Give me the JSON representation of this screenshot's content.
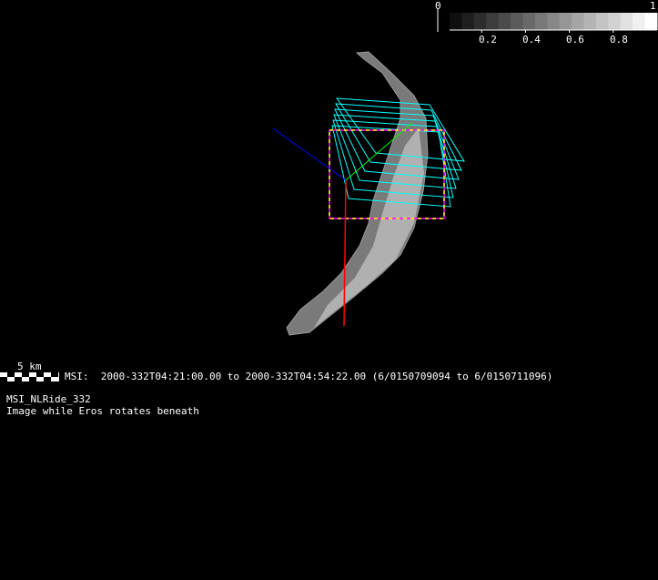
{
  "colorbar": {
    "min_label": "0",
    "max_label": "1",
    "tick_labels": [
      "0.2",
      "0.4",
      "0.6",
      "0.8"
    ],
    "segments": 17
  },
  "scale_bar": {
    "label": "5 km"
  },
  "info": {
    "time_range": "MSI:  2000-332T04:21:00.00 to 2000-332T04:54:22.00 (6/0150709094 to 6/0150711096)",
    "name": "MSI_NLRide_332",
    "description": "Image while Eros rotates beneath"
  },
  "colors": {
    "frames": "#00ffff",
    "boresight_box_a": "#ff00ff",
    "boresight_box_b": "#ffff00",
    "axis_x": "#ff0000",
    "axis_y": "#00ff00",
    "axis_z": "#0000ff"
  }
}
